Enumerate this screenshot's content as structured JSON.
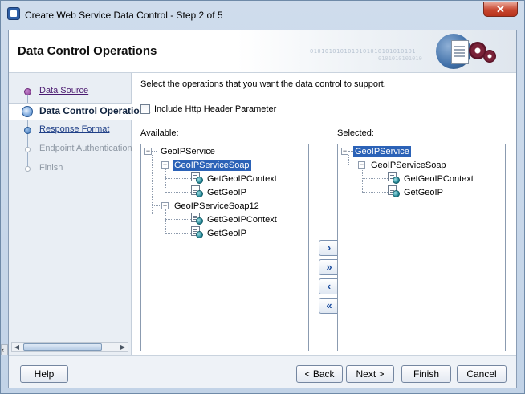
{
  "window": {
    "title": "Create Web Service Data Control - Step 2 of 5",
    "close_glyph": "✕"
  },
  "banner": {
    "title": "Data Control Operations",
    "bits_line1": "0101010101010101010101010101",
    "bits_line2": "0101010101010"
  },
  "nav": {
    "items": [
      {
        "label": "Data Source",
        "state": "visited"
      },
      {
        "label": "Data Control Operations",
        "state": "current"
      },
      {
        "label": "Response Format",
        "state": "link"
      },
      {
        "label": "Endpoint Authentication",
        "state": "disabled"
      },
      {
        "label": "Finish",
        "state": "disabled"
      }
    ]
  },
  "main": {
    "instruction": "Select the operations that you want the data control to support.",
    "include_http_header": {
      "label": "Include Http Header Parameter",
      "checked": false
    },
    "available_label": "Available:",
    "selected_label": "Selected:",
    "available_tree": [
      {
        "label": "GeoIPService",
        "level": 0,
        "expanded": true
      },
      {
        "label": "GeoIPServiceSoap",
        "level": 1,
        "expanded": true,
        "highlighted": true
      },
      {
        "label": "GetGeoIPContext",
        "level": 2
      },
      {
        "label": "GetGeoIP",
        "level": 2
      },
      {
        "label": "GeoIPServiceSoap12",
        "level": 1,
        "expanded": true
      },
      {
        "label": "GetGeoIPContext",
        "level": 2
      },
      {
        "label": "GetGeoIP",
        "level": 2
      }
    ],
    "selected_tree": [
      {
        "label": "GeoIPService",
        "level": 0,
        "expanded": true,
        "highlighted": true
      },
      {
        "label": "GeoIPServiceSoap",
        "level": 1,
        "expanded": true
      },
      {
        "label": "GetGeoIPContext",
        "level": 2
      },
      {
        "label": "GetGeoIP",
        "level": 2
      }
    ],
    "shuttle": {
      "add": "›",
      "add_all": "»",
      "remove": "‹",
      "remove_all": "«"
    }
  },
  "footer": {
    "help": "Help",
    "back": "< Back",
    "next": "Next >",
    "finish": "Finish",
    "cancel": "Cancel"
  },
  "icons": {
    "operation": "operation-icon",
    "expand": "minus-toggle-icon"
  }
}
